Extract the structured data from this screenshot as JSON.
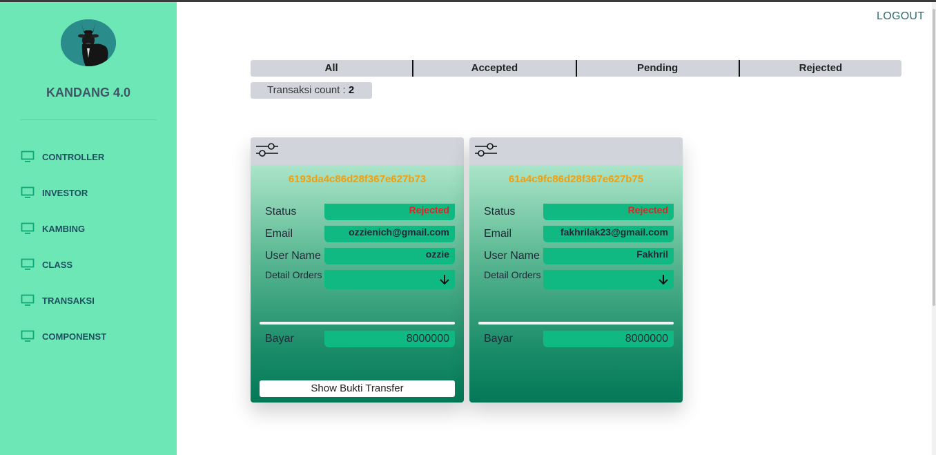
{
  "app": {
    "brand": "KANDANG 4.0",
    "logout": "LOGOUT"
  },
  "sidebar": {
    "items": [
      {
        "label": "CONTROLLER",
        "icon": "monitor-icon"
      },
      {
        "label": "INVESTOR",
        "icon": "monitor-icon"
      },
      {
        "label": "KAMBING",
        "icon": "monitor-icon"
      },
      {
        "label": "CLASS",
        "icon": "monitor-icon"
      },
      {
        "label": "TRANSAKSI",
        "icon": "monitor-icon"
      },
      {
        "label": "COMPONENST",
        "icon": "monitor-icon"
      }
    ]
  },
  "filters": {
    "tabs": [
      "All",
      "Accepted",
      "Pending",
      "Rejected"
    ],
    "count_label": "Transaksi count : ",
    "count_value": "2"
  },
  "labels": {
    "status": "Status",
    "email": "Email",
    "username": "User Name",
    "detail_orders": "Detail Orders",
    "bayar": "Bayar",
    "show_bukti": "Show Bukti Transfer"
  },
  "transactions": [
    {
      "id": "6193da4c86d28f367e627b73",
      "status": "Rejected",
      "email": "ozzienich@gmail.com",
      "username": "ozzie",
      "bayar": "8000000"
    },
    {
      "id": "61a4c9fc86d28f367e627b75",
      "status": "Rejected",
      "email": "fakhrilak23@gmail.com",
      "username": "Fakhril",
      "bayar": "8000000"
    }
  ],
  "colors": {
    "sidebar": "#6ee7b7",
    "accent_field": "#10b981",
    "id_text": "#f59e0b",
    "rejected": "#dc2626"
  }
}
